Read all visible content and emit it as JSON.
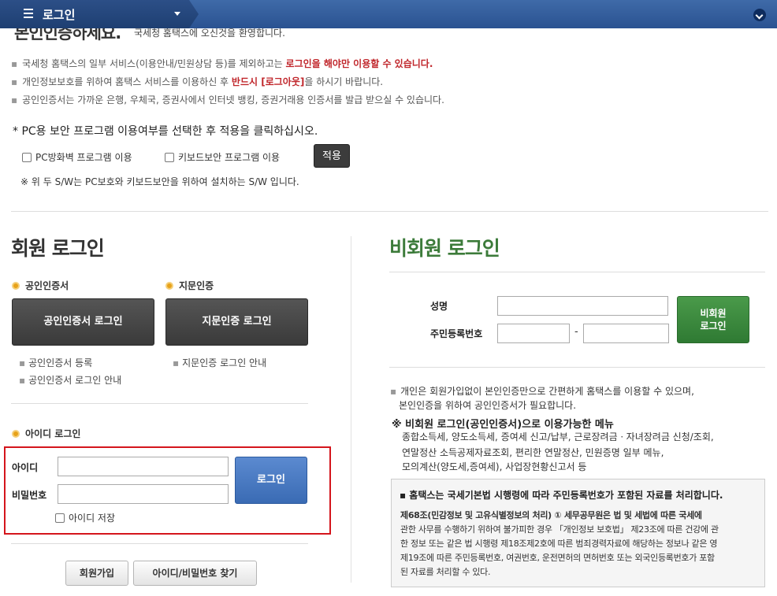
{
  "topbar": {
    "menu_label": "로그인"
  },
  "intro": {
    "heading": "본인인증하세요.",
    "subheading": "국세청 홈택스에 오신것을 환영합니다."
  },
  "notices": [
    {
      "pre": "국세청 홈택스의 일부 서비스(이용안내/민원상담 등)를 제외하고는 ",
      "hl": "로그인을 해야만 이용할 수 있습니다.",
      "post": ""
    },
    {
      "pre": "개인정보보호를 위하여 홈택스 서비스를 이용하신 후 ",
      "hl": "반드시 [로그아웃]",
      "post": "을 하시기 바랍니다."
    },
    {
      "pre": "공인인증서는 가까운 은행, 우체국, 증권사에서 인터넷 뱅킹, 증권거래용 인증서를 발급 받으실 수 있습니다.",
      "hl": "",
      "post": ""
    }
  ],
  "security": {
    "title": "* PC용 보안 프로그램 이용여부를 선택한 후 적용을 클릭하십시오.",
    "firewall_label": "PC방화벽 프로그램 이용",
    "keyboard_label": "키보드보안 프로그램 이용",
    "apply_label": "적용",
    "note": "※ 위 두 S/W는 PC보호와 키보드보안을 위하여 설치하는 S/W 입니다."
  },
  "member": {
    "title": "회원 로그인",
    "cert_heading": "공인인증서",
    "finger_heading": "지문인증",
    "cert_button": "공인인증서 로그인",
    "finger_button": "지문인증 로그인",
    "cert_links": [
      "공인인증서 등록",
      "공인인증서 로그인 안내"
    ],
    "finger_links": [
      "지문인증 로그인 안내"
    ],
    "id_heading": "아이디 로그인",
    "id_label": "아이디",
    "pw_label": "비밀번호",
    "login_button": "로그인",
    "save_id_label": "아이디 저장",
    "join_button": "회원가입",
    "find_button": "아이디/비밀번호 찾기"
  },
  "guest": {
    "title": "비회원 로그인",
    "name_label": "성명",
    "rrn_label": "주민등록번호",
    "rrn_sep": "-",
    "login_button_line1": "비회원",
    "login_button_line2": "로그인",
    "desc_line1": "개인은 회원가입없이 본인인증만으로 간편하게 홈택스를 이용할 수 있으며,",
    "desc_line2": "본인인증을 위하여 공인인증서가 필요합니다.",
    "menu_title": "※ 비회원 로그인(공인인증서)으로 이용가능한 메뉴",
    "menu_lines": [
      "종합소득세, 양도소득세, 증여세 신고/납부, 근로장려금ㆍ자녀장려금 신청/조회,",
      "연말정산 소득공제자료조회, 편리한 연말정산, 민원증명 일부 메뉴,",
      "모의계산(양도세,증여세), 사업장현황신고서 등"
    ],
    "info_head": "▪ 홈택스는 국세기본법 시행령에 따라 주민등록번호가 포함된 자료를 처리합니다.",
    "info_lines": [
      "제68조(민감정보 및 고유식별정보의 처리) ① 세무공무원은 법 및 세법에 따른 국세에",
      "관한 사무를 수행하기 위하여 불가피한 경우 「개인정보 보호법」 제23조에 따른 건강에 관",
      "한 정보 또는 같은 법 시행령 제18조제2호에 따른 범죄경력자료에 해당하는 정보나 같은 영",
      "제19조에 따른 주민등록번호, 여권번호, 운전면허의 면허번호 또는 외국인등록번호가 포함",
      "된 자료를 처리할 수 있다."
    ]
  }
}
